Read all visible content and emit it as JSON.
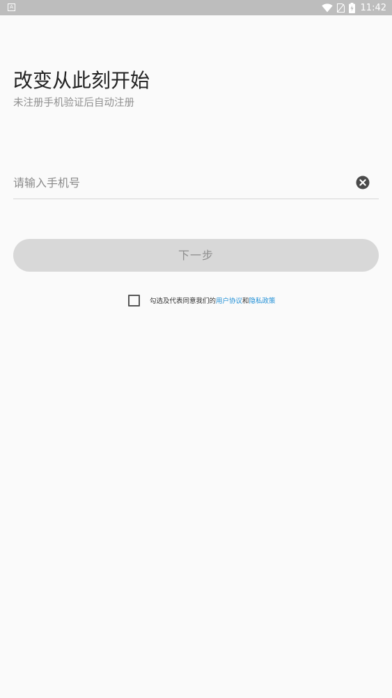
{
  "status_bar": {
    "app_icon": "A",
    "time": "11:42",
    "icons": [
      "wifi-icon",
      "sim-icon",
      "battery-icon"
    ]
  },
  "header": {
    "title": "改变从此刻开始",
    "subtitle": "未注册手机验证后自动注册"
  },
  "form": {
    "phone_placeholder": "请输入手机号",
    "phone_value": "",
    "clear_icon": "clear-icon",
    "next_label": "下一步"
  },
  "agreement": {
    "prefix": "勾选及代表同意我们的",
    "user_agreement": "用户协议",
    "conjunction": "和",
    "privacy_policy": "隐私政策",
    "checked": false
  },
  "colors": {
    "status_bar": "#bdbdbd",
    "background": "#fafafa",
    "button_disabled": "#d8d8d8",
    "link": "#1f8fd6"
  }
}
